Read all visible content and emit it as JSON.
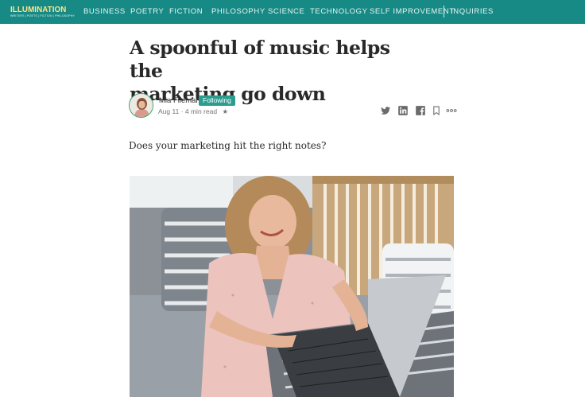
{
  "nav": {
    "logo": {
      "wordmark": "ILLUMINATION",
      "tagline": "WRITERS | POETS | FICTION | PHILOSOPHY"
    },
    "items": [
      {
        "label": "BUSINESS"
      },
      {
        "label": "POETRY"
      },
      {
        "label": "FICTION"
      },
      {
        "label": "PHILOSOPHY"
      },
      {
        "label": "SCIENCE"
      },
      {
        "label": "TECHNOLOGY"
      },
      {
        "label": "SELF IMPROVEMENT"
      },
      {
        "label": "INQUIRIES"
      }
    ],
    "colors": {
      "bar": "#178a85",
      "logo": "#ffe48a"
    }
  },
  "article": {
    "title_line1": "A spoonful of music helps the",
    "title_line2": "marketing go down",
    "author": {
      "name": "Mia Fileman",
      "follow_label": "Following",
      "date": "Aug 11",
      "read_time": "4 min read",
      "star": "★"
    },
    "share_icons": [
      "twitter-icon",
      "linkedin-icon",
      "facebook-icon",
      "bookmark-icon",
      "more-icon"
    ],
    "lede": "Does your marketing hit the right notes?"
  },
  "colors": {
    "accent": "#2a9d8f",
    "text": "#292929",
    "muted": "#757575"
  }
}
